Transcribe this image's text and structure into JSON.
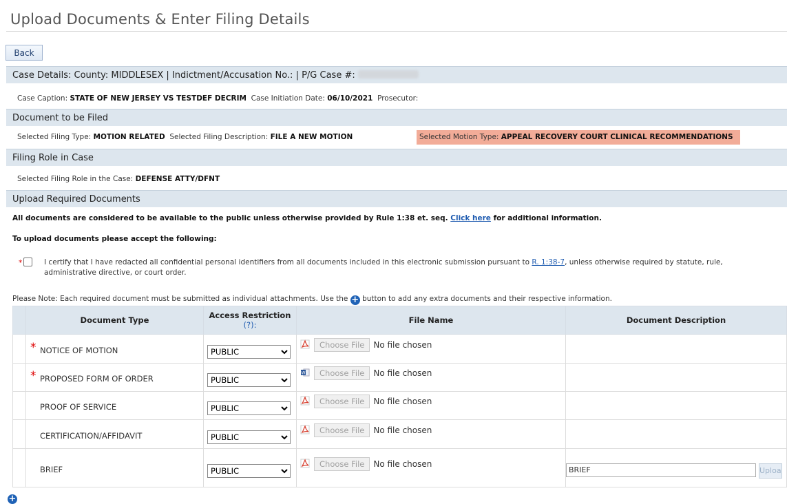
{
  "page": {
    "title": "Upload Documents & Enter Filing Details",
    "back_label": "Back"
  },
  "case_details": {
    "header": "Case Details: County: MIDDLESEX | Indictment/Accusation No.:  | P/G Case #:",
    "caption_label": "Case Caption:",
    "caption_value": "STATE OF NEW JERSEY VS TESTDEF DECRIM",
    "initiation_label": "Case Initiation Date:",
    "initiation_value": "06/10/2021",
    "prosecutor_label": "Prosecutor:"
  },
  "document_to_be_filed": {
    "header": "Document to be Filed",
    "filing_type_label": "Selected Filing Type:",
    "filing_type_value": "MOTION RELATED",
    "filing_desc_label": "Selected Filing Description:",
    "filing_desc_value": "FILE A NEW MOTION",
    "motion_type_label": "Selected Motion Type:",
    "motion_type_value": "APPEAL RECOVERY COURT CLINICAL RECOMMENDATIONS",
    "highlight_color": "#f2ac98"
  },
  "filing_role": {
    "header": "Filing Role in Case",
    "role_label": "Selected Filing Role in the Case:",
    "role_value": "DEFENSE ATTY/DFNT"
  },
  "upload": {
    "header": "Upload Required Documents",
    "public_notice_before": "All documents are considered to be available to the public unless otherwise provided by Rule 1:38 et. seq.",
    "public_notice_link": "Click here",
    "public_notice_after": "for additional information.",
    "accept_text": "To upload documents please accept the following:",
    "cert_text_before": "I certify that I have redacted all confidential personal identifiers from all documents included in this electronic submission pursuant to",
    "cert_link": "R. 1:38-7",
    "cert_text_after": ", unless otherwise required by statute, rule, administrative directive, or court order.",
    "note_before": "Please Note: Each required document must be submitted as individual attachments. Use the",
    "note_after": "button to add any extra documents and their respective information."
  },
  "table": {
    "headers": {
      "document_type": "Document Type",
      "access_restriction": "Access Restriction",
      "access_help": "(?):",
      "file_name": "File Name",
      "document_description": "Document Description"
    },
    "choose_file_label": "Choose File",
    "no_file_label": "No file chosen",
    "rows": [
      {
        "doc_type": "NOTICE OF MOTION",
        "required": true,
        "access": "PUBLIC",
        "icon": "pdf-icon"
      },
      {
        "doc_type": "PROPOSED FORM OF ORDER",
        "required": true,
        "access": "PUBLIC",
        "icon": "word-icon"
      },
      {
        "doc_type": "PROOF OF SERVICE",
        "required": false,
        "access": "PUBLIC",
        "icon": "pdf-icon"
      },
      {
        "doc_type": "CERTIFICATION/AFFIDAVIT",
        "required": false,
        "access": "PUBLIC",
        "icon": "pdf-icon"
      },
      {
        "doc_type": "BRIEF",
        "required": false,
        "access": "PUBLIC",
        "icon": "pdf-icon",
        "description": "BRIEF",
        "upload_label": "Upload"
      }
    ]
  }
}
